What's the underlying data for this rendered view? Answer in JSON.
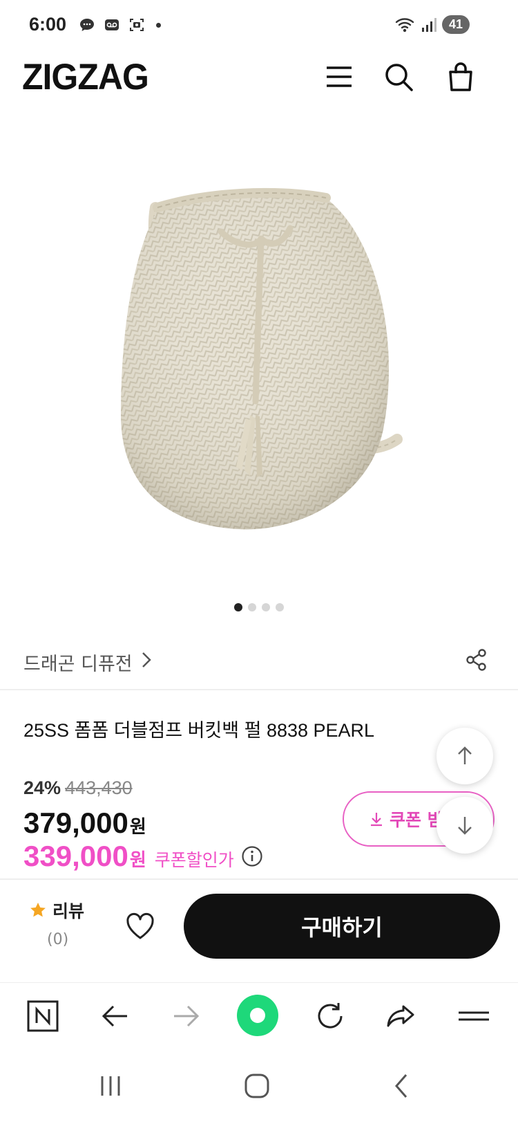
{
  "status_bar": {
    "time": "6:00",
    "battery": "41"
  },
  "header": {
    "logo": "ZIGZAG",
    "icons": [
      "menu-icon",
      "search-icon",
      "shopping-bag-icon"
    ]
  },
  "product": {
    "image_description_icon": "woven-bucket-bag-image",
    "carousel": {
      "total": 4,
      "active_index": 0
    },
    "store_name": "드래곤 디퓨전",
    "title": "25SS 폼폼 더블점프 버킷백 펄 8838 PEARL",
    "discount_rate": "24%",
    "original_price": "443,430",
    "price": "379,000",
    "price_unit": "원",
    "coupon_price": "339,000",
    "coupon_price_unit": "원",
    "coupon_label": "쿠폰할인가",
    "coupon_button_label": "쿠폰 받"
  },
  "purchase_bar": {
    "review_label": "리뷰",
    "review_count": "(0)",
    "buy_label": "구매하기"
  },
  "colors": {
    "accent_pink": "#f04fc6",
    "buy_button": "#111111",
    "naver_green": "#1ed87a"
  }
}
